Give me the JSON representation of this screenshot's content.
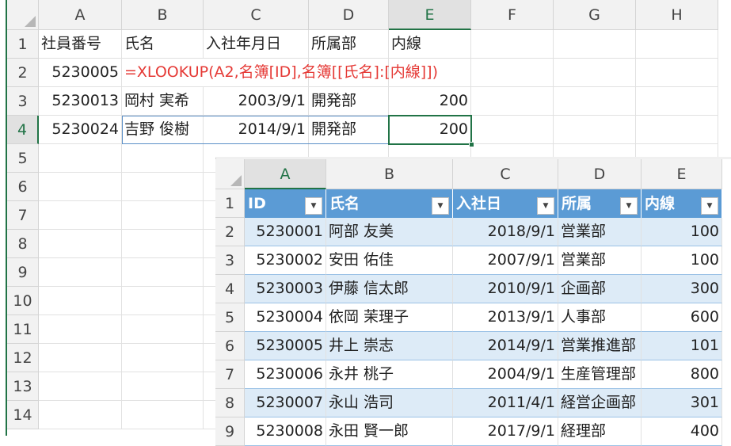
{
  "colors": {
    "accent": "#217346",
    "table_header": "#5b9bd5",
    "band": "#ddebf7",
    "formula": "#e53935"
  },
  "icons": {
    "filter": "filter-dropdown-icon"
  },
  "sheet1": {
    "columns": [
      "A",
      "B",
      "C",
      "D",
      "E",
      "F",
      "G",
      "H"
    ],
    "rows": [
      "1",
      "2",
      "3",
      "4",
      "5",
      "6",
      "7",
      "8",
      "9",
      "10",
      "11",
      "12",
      "13",
      "14"
    ],
    "cells": {
      "a1": "社員番号",
      "b1": "氏名",
      "c1": "入社年月日",
      "d1": "所属部",
      "e1": "内線",
      "a2": "5230005",
      "b2": "=XLOOKUP(A2,名簿[ID],名簿[[氏名]:[内線]])",
      "a3": "5230013",
      "b3": "岡村 実希",
      "c3": "2003/9/1",
      "d3": "開発部",
      "e3": "200",
      "a4": "5230024",
      "b4": "吉野 俊樹",
      "c4": "2014/9/1",
      "d4": "開発部",
      "e4": "200"
    }
  },
  "sheet2": {
    "columns": [
      "A",
      "B",
      "C",
      "D",
      "E"
    ],
    "rows": [
      "1",
      "2",
      "3",
      "4",
      "5",
      "6",
      "7",
      "8",
      "9"
    ],
    "headers": [
      "ID",
      "氏名",
      "入社日",
      "所属",
      "内線"
    ],
    "data": [
      [
        "5230001",
        "阿部 友美",
        "2018/9/1",
        "営業部",
        "100"
      ],
      [
        "5230002",
        "安田 佑佳",
        "2007/9/1",
        "営業部",
        "100"
      ],
      [
        "5230003",
        "伊藤 信太郎",
        "2010/9/1",
        "企画部",
        "300"
      ],
      [
        "5230004",
        "依岡 茉理子",
        "2013/9/1",
        "人事部",
        "600"
      ],
      [
        "5230005",
        "井上 崇志",
        "2014/9/1",
        "営業推進部",
        "101"
      ],
      [
        "5230006",
        "永井 桃子",
        "2004/9/1",
        "生産管理部",
        "800"
      ],
      [
        "5230007",
        "永山 浩司",
        "2011/4/1",
        "経営企画部",
        "301"
      ],
      [
        "5230008",
        "永田 賢一郎",
        "2017/9/1",
        "経理部",
        "400"
      ]
    ]
  }
}
